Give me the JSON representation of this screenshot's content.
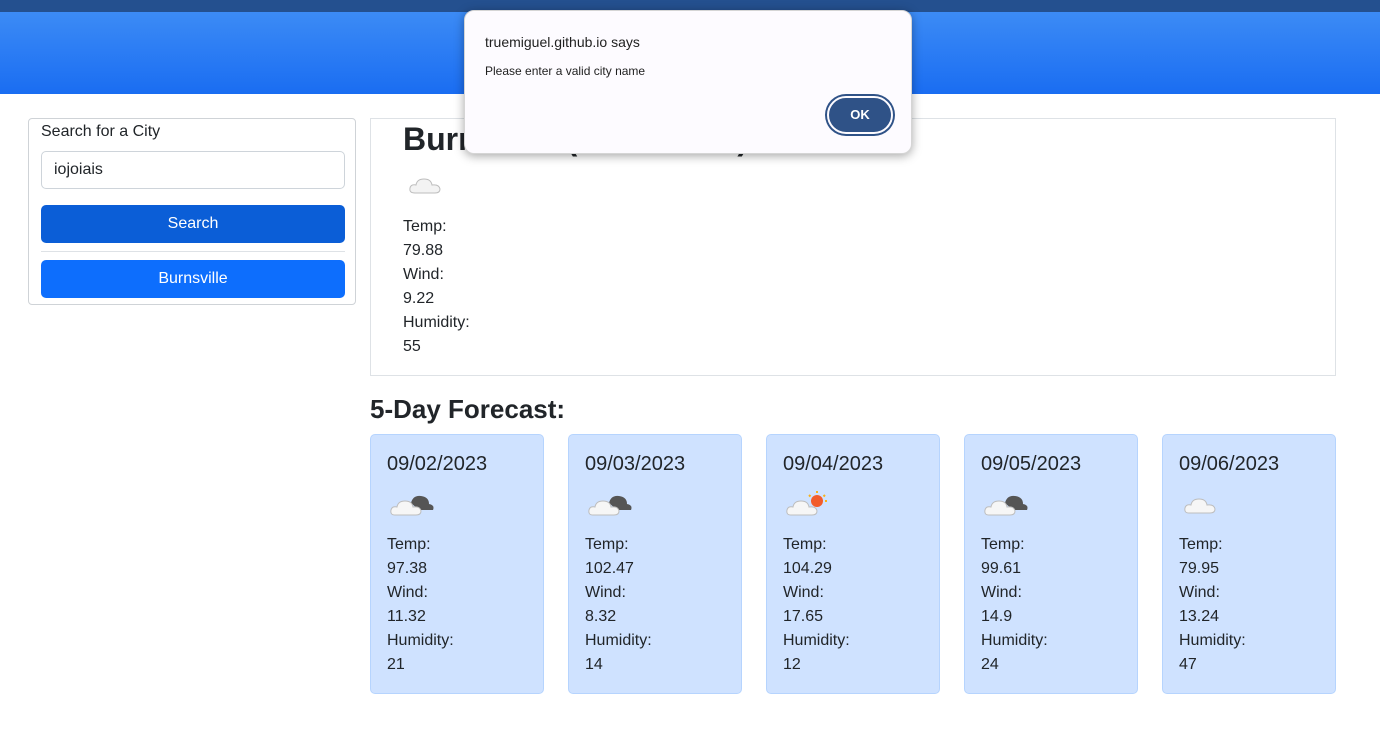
{
  "search": {
    "title": "Search for a City",
    "input_value": "iojoiais",
    "search_label": "Search",
    "history": [
      "Burnsville"
    ]
  },
  "current": {
    "city": "Burnsville (09/01/2023)",
    "icon": "cloud-icon",
    "temp_label": "Temp:",
    "temp": "79.88",
    "wind_label": "Wind:",
    "wind": "9.22",
    "humidity_label": "Humidity:",
    "humidity": "55"
  },
  "forecast": {
    "title": "5-Day Forecast:",
    "days": [
      {
        "date": "09/02/2023",
        "icon": "broken-clouds-icon",
        "temp": "97.38",
        "wind": "11.32",
        "humidity": "21"
      },
      {
        "date": "09/03/2023",
        "icon": "broken-clouds-icon",
        "temp": "102.47",
        "wind": "8.32",
        "humidity": "14"
      },
      {
        "date": "09/04/2023",
        "icon": "few-clouds-icon",
        "temp": "104.29",
        "wind": "17.65",
        "humidity": "12"
      },
      {
        "date": "09/05/2023",
        "icon": "broken-clouds-icon",
        "temp": "99.61",
        "wind": "14.9",
        "humidity": "24"
      },
      {
        "date": "09/06/2023",
        "icon": "cloud-icon",
        "temp": "79.95",
        "wind": "13.24",
        "humidity": "47"
      }
    ]
  },
  "dialog": {
    "title": "truemiguel.github.io says",
    "message": "Please enter a valid city name",
    "ok_label": "OK"
  },
  "colors": {
    "header": "#1a6df2",
    "button_primary": "#0d6efd",
    "card_bg": "#cfe2ff",
    "dialog_button": "#2f5287"
  }
}
